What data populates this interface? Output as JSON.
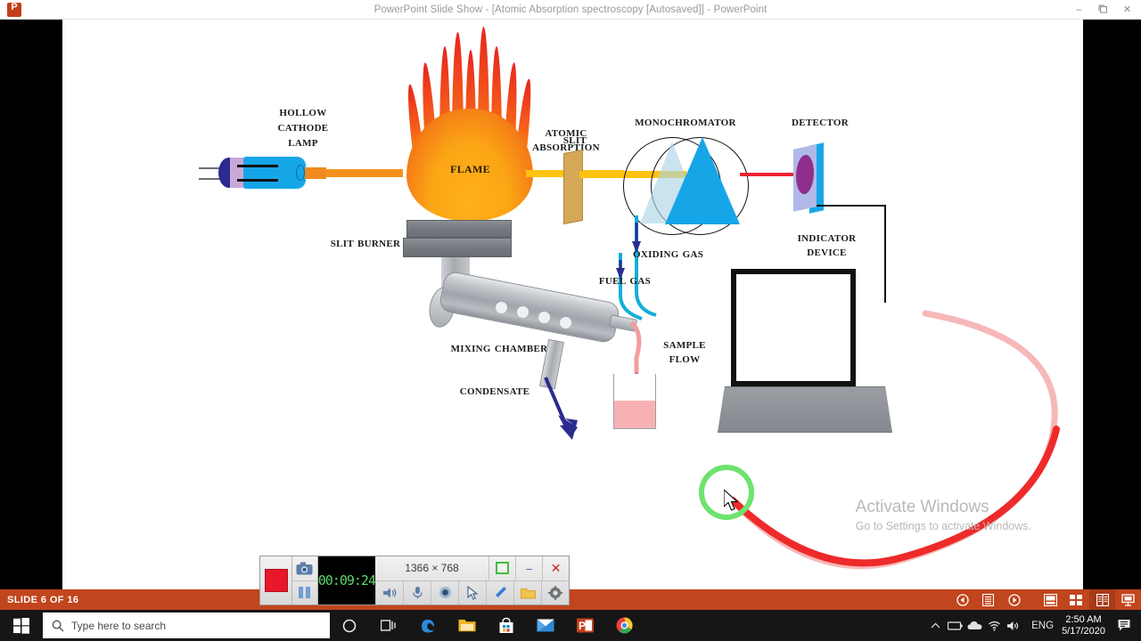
{
  "window": {
    "title": "PowerPoint Slide Show - [Atomic Absorption spectroscopy [Autosaved]] - PowerPoint",
    "app_icon": "powerpoint-icon",
    "minimize": "–",
    "restore": "❐",
    "close": "✕"
  },
  "slide": {
    "labels": {
      "hollow_cathode_lamp": "Hollow\nCathode\nLamp",
      "flame": "Flame",
      "atomic_absorption": "Atomic\nAbsorption",
      "slit": "Slit",
      "monochromator": "Monochromator",
      "detector": "Detector",
      "indicator_device": "Indicator\nDevice",
      "slit_burner": "Slit Burner",
      "oxiding_gas": "Oxiding Gas",
      "fuel_gas": "Fuel Gas",
      "mixing_chamber": "Mixing Chamber",
      "sample_flow": "Sample\nFlow",
      "condensate": "Condensate"
    },
    "colors": {
      "flame_top": "#e8251f",
      "flame_bottom": "#ffb11b",
      "lamp_body": "#16a6e8",
      "beam_yellow": "#ffc20e",
      "beam_red": "#ee2233",
      "prism": "#16a6e8",
      "detector_dot": "#8e2f8e",
      "sample_liquid": "#f9b2b4",
      "ink_pen": "#e8202a",
      "ink_highlighter": "#6ee26e"
    }
  },
  "watermark": {
    "title": "Activate Windows",
    "subtitle": "Go to Settings to activate Windows."
  },
  "recorder": {
    "stop_button": "stop-recording-button",
    "camera_button": "screenshot-camera-icon",
    "pause_button": "pause-icon",
    "timer": "00:09:24",
    "resolution": "1366 × 768",
    "region_button": "region-select-icon",
    "minimize_button": "–",
    "close_button": "✕",
    "tools": [
      {
        "name": "speaker-icon",
        "glyph": "🔊"
      },
      {
        "name": "microphone-icon",
        "glyph": "🎙"
      },
      {
        "name": "webcam-icon",
        "glyph": "◉"
      },
      {
        "name": "cursor-icon",
        "glyph": "➤"
      },
      {
        "name": "pen-icon",
        "glyph": "✒"
      },
      {
        "name": "folder-icon",
        "glyph": "📁"
      },
      {
        "name": "settings-gear-icon",
        "glyph": "⚙"
      }
    ]
  },
  "statusbar": {
    "slide_count": "SLIDE 6 OF 16",
    "icons": [
      {
        "name": "previous-slide-icon",
        "glyph": "◀"
      },
      {
        "name": "menu-options-icon",
        "glyph": "☰"
      },
      {
        "name": "next-slide-icon",
        "glyph": "▶"
      },
      {
        "name": "normal-view-icon",
        "glyph": "▤"
      },
      {
        "name": "slide-sorter-icon",
        "glyph": "▦"
      },
      {
        "name": "reading-view-icon",
        "glyph": "▥"
      },
      {
        "name": "slideshow-view-icon",
        "glyph": "☒"
      }
    ]
  },
  "taskbar": {
    "start_button": "windows-start-icon",
    "search_placeholder": "Type here to search",
    "search_icon": "search-icon",
    "cortana_icon": "cortana-circle-icon",
    "apps": [
      {
        "name": "task-view-icon"
      },
      {
        "name": "edge-browser-icon"
      },
      {
        "name": "file-explorer-icon"
      },
      {
        "name": "microsoft-store-icon"
      },
      {
        "name": "mail-icon"
      },
      {
        "name": "powerpoint-icon"
      },
      {
        "name": "chrome-icon"
      }
    ],
    "tray": {
      "show_hidden_icons": "chevron-up-icon",
      "battery_icon": "battery-icon",
      "onedrive_icon": "onedrive-cloud-icon",
      "network_icon": "wifi-icon",
      "volume_icon": "speaker-icon",
      "language": "ENG",
      "time": "2:50 AM",
      "date": "5/17/2020",
      "action_center": "notifications-icon"
    }
  }
}
